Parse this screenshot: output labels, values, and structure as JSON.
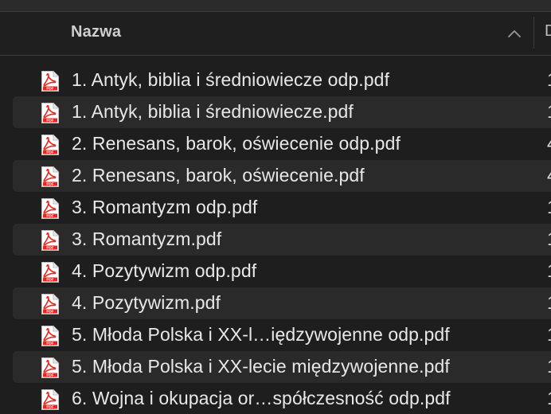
{
  "header": {
    "name_column": "Nazwa",
    "next_column_partial": "D"
  },
  "files": [
    {
      "name": "1. Antyk, biblia i średniowiecze odp.pdf",
      "next": "1"
    },
    {
      "name": "1. Antyk, biblia i średniowiecze.pdf",
      "next": "1"
    },
    {
      "name": "2. Renesans, barok, oświecenie odp.pdf",
      "next": "4"
    },
    {
      "name": "2. Renesans, barok, oświecenie.pdf",
      "next": "4"
    },
    {
      "name": "3. Romantyzm odp.pdf",
      "next": "1"
    },
    {
      "name": "3. Romantyzm.pdf",
      "next": "1"
    },
    {
      "name": "4. Pozytywizm odp.pdf",
      "next": "1"
    },
    {
      "name": "4. Pozytywizm.pdf",
      "next": "1"
    },
    {
      "name": "5. Młoda Polska i XX-l…iędzywojenne odp.pdf",
      "next": "1"
    },
    {
      "name": "5. Młoda Polska i XX-lecie międzywojenne.pdf",
      "next": "1"
    },
    {
      "name": "6. Wojna i okupacja or…spółczesność odp.pdf",
      "next": "1"
    }
  ],
  "icons": {
    "file_icon": "pdf-file-icon",
    "sort_icon": "chevron-up-icon"
  },
  "colors": {
    "background": "#1e1e1e",
    "alt_row": "#2a2a2a",
    "pdf_red": "#e3261f",
    "text": "#e8e8e8"
  }
}
